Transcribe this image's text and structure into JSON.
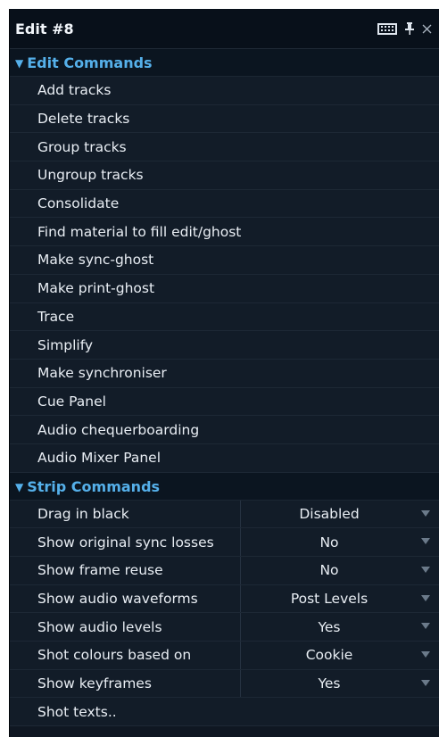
{
  "panel": {
    "title": "Edit #8"
  },
  "edit_commands": {
    "header": "Edit Commands",
    "items": [
      {
        "label": "Add tracks"
      },
      {
        "label": "Delete tracks"
      },
      {
        "label": "Group tracks"
      },
      {
        "label": "Ungroup tracks"
      },
      {
        "label": "Consolidate"
      },
      {
        "label": "Find material to fill edit/ghost"
      },
      {
        "label": "Make sync-ghost"
      },
      {
        "label": "Make print-ghost"
      },
      {
        "label": "Trace"
      },
      {
        "label": "Simplify"
      },
      {
        "label": "Make synchroniser"
      },
      {
        "label": "Cue Panel"
      },
      {
        "label": "Audio chequerboarding"
      },
      {
        "label": "Audio Mixer Panel"
      }
    ]
  },
  "strip_commands": {
    "header": "Strip Commands",
    "props": [
      {
        "label": "Drag in black",
        "value": "Disabled"
      },
      {
        "label": "Show original sync losses",
        "value": "No"
      },
      {
        "label": "Show frame reuse",
        "value": "No"
      },
      {
        "label": "Show audio waveforms",
        "value": "Post Levels"
      },
      {
        "label": "Show audio levels",
        "value": "Yes"
      },
      {
        "label": "Shot colours based on",
        "value": "Cookie"
      },
      {
        "label": "Show keyframes",
        "value": "Yes"
      }
    ],
    "last_item": "Shot texts.."
  }
}
